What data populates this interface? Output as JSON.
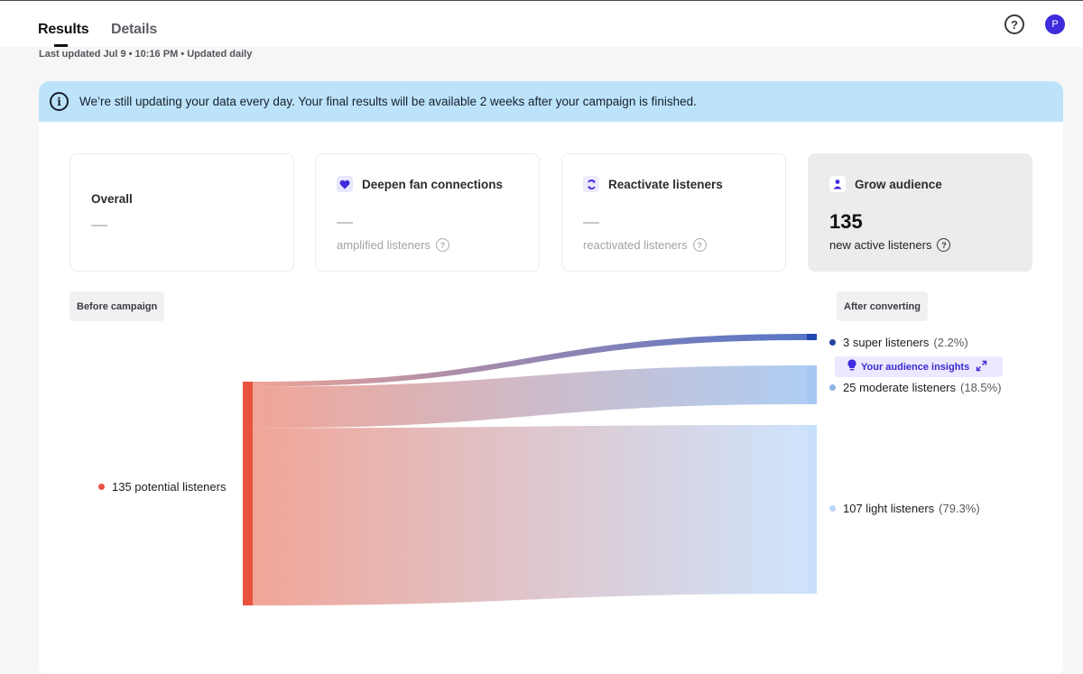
{
  "tabs": {
    "results": "Results",
    "details": "Details"
  },
  "header": {
    "help": "?",
    "avatar_initial": "P"
  },
  "updated": "Last updated Jul 9 • 10:16 PM • Updated daily",
  "banner": {
    "icon": "i",
    "text": "We’re still updating your data every day. Your final results will be available 2 weeks after your campaign is finished."
  },
  "cards": {
    "overall": {
      "title": "Overall"
    },
    "deepen": {
      "title": "Deepen fan connections",
      "sub": "amplified listeners",
      "icon": "heart-icon"
    },
    "reactivate": {
      "title": "Reactivate listeners",
      "sub": "reactivated listeners",
      "icon": "refresh-icon"
    },
    "grow": {
      "title": "Grow audience",
      "value": "135",
      "sub": "new active listeners",
      "icon": "person-icon"
    }
  },
  "help_mark": "?",
  "chips": {
    "before": "Before campaign",
    "after": "After converting"
  },
  "insights": {
    "label": "Your audience insights"
  },
  "chart_data": {
    "type": "sankey",
    "source": {
      "label": "135 potential listeners",
      "value": 135,
      "color": "#e8523f"
    },
    "targets": [
      {
        "label": "3 super listeners",
        "pct": "(2.2%)",
        "value": 3,
        "color": "#2148b3",
        "dot": "#24449f"
      },
      {
        "label": "25 moderate listeners",
        "pct": "(18.5%)",
        "value": 25,
        "color": "#a6c8f2",
        "dot": "#8fb4e8"
      },
      {
        "label": "107 light listeners",
        "pct": "(79.3%)",
        "value": 107,
        "color": "#c9e0fb",
        "dot": "#bcd6f6"
      }
    ]
  }
}
